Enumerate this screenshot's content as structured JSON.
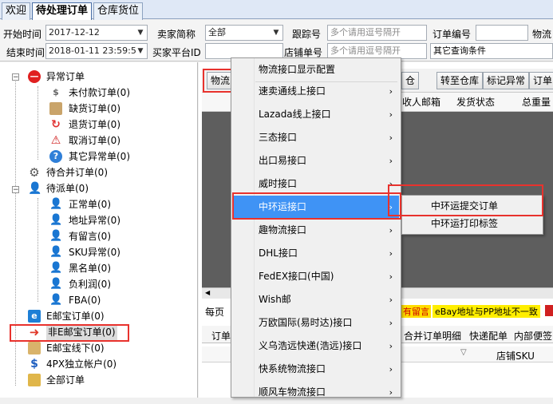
{
  "tabs": [
    {
      "label": "欢迎"
    },
    {
      "label": "待处理订单"
    },
    {
      "label": "仓库货位"
    }
  ],
  "filter": {
    "start_label": "开始时间",
    "start_value": "2017-12-12",
    "end_label": "结束时间",
    "end_value": "2018-01-11 23:59:5",
    "seller_label": "卖家简称",
    "seller_value": "全部",
    "buyer_label": "买家平台ID",
    "buyer_value": "",
    "tracking_label": "跟踪号",
    "tracking_placeholder": "多个请用逗号隔开",
    "storeorder_label": "店铺单号",
    "storeorder_placeholder": "多个请用逗号隔开",
    "orderno_label": "订单编号",
    "logistics_label": "物流",
    "other_label": "其它查询条件"
  },
  "tree": {
    "abnormal": "异常订单",
    "unpaid": "未付款订单(0)",
    "stockout": "缺货订单(0)",
    "refund": "退货订单(0)",
    "cancel": "取消订单(0)",
    "other_abnormal": "其它异常单(0)",
    "merge": "待合并订单(0)",
    "dispatch": "待派单(0)",
    "normal": "正常单(0)",
    "address": "地址异常(0)",
    "message": "有留言(0)",
    "sku": "SKU异常(0)",
    "blacklist": "黑名单(0)",
    "negative": "负利润(0)",
    "fba": "FBA(0)",
    "ebay": "E邮宝订单(0)",
    "non_ebay": "非E邮宝订单(0)",
    "ebay_offline": "E邮宝线下(0)",
    "fourpx": "4PX独立帐户(0)",
    "all": "全部订单"
  },
  "grid": {
    "btn_logistics": "物流",
    "btn_warehouse_tail": "仓",
    "btn_transfer": "转至仓库",
    "btn_mark": "标记异常",
    "btn_order": "订单",
    "col_email": "收人邮箱",
    "col_ship": "发货状态",
    "col_weight": "总重量",
    "per_page": "每页",
    "warning_msg": "eBay地址与PP地址不一致",
    "warning_tag": "有留言",
    "bottom_tab_order": "订单",
    "bottom_tab_merge": "合并订单明细",
    "bottom_tab_fast": "快递配单",
    "bottom_tab_internal": "内部便签",
    "store_sku": "店铺SKU"
  },
  "menu": {
    "items": [
      {
        "label": "物流接口显示配置",
        "arrow": ""
      },
      {
        "label": "速卖通线上接口",
        "arrow": "›"
      },
      {
        "label": "Lazada线上接口",
        "arrow": "›"
      },
      {
        "label": "三态接口",
        "arrow": "›"
      },
      {
        "label": "出口易接口",
        "arrow": "›"
      },
      {
        "label": "威时接口",
        "arrow": "›"
      },
      {
        "label": "中环运接口",
        "arrow": "›"
      },
      {
        "label": "趣物流接口",
        "arrow": "›"
      },
      {
        "label": "DHL接口",
        "arrow": "›"
      },
      {
        "label": "FedEX接口(中国)",
        "arrow": "›"
      },
      {
        "label": "Wish邮",
        "arrow": "›"
      },
      {
        "label": "万欧国际(易时达)接口",
        "arrow": "›"
      },
      {
        "label": "义乌浩远快递(浩远)接口",
        "arrow": "›"
      },
      {
        "label": "快系统物流接口",
        "arrow": "›"
      },
      {
        "label": "顺风车物流接口",
        "arrow": "›"
      }
    ],
    "highlighted_index": 6
  },
  "submenu": {
    "items": [
      {
        "label": "中环运提交订单"
      },
      {
        "label": "中环运打印标签"
      }
    ]
  },
  "colors": {
    "highlight": "#3f93f5",
    "annotation_red": "#e8322d"
  }
}
